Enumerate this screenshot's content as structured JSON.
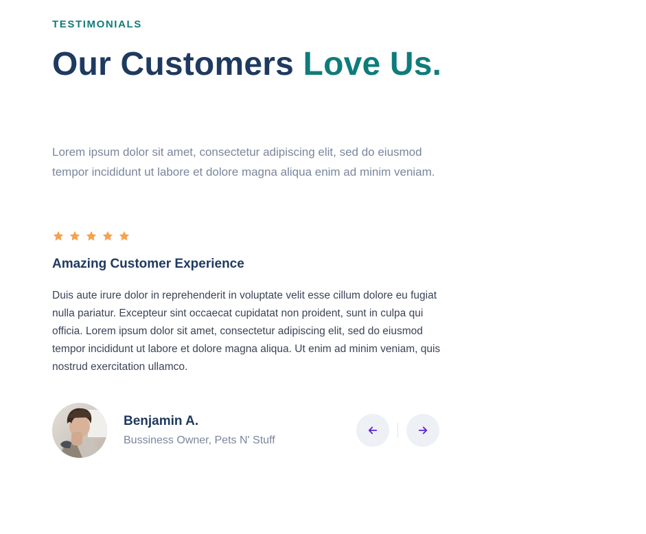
{
  "testimonials": {
    "eyebrow": "TESTIMONIALS",
    "heading_main": "Our Customers ",
    "heading_accent": "Love Us.",
    "intro": "Lorem ipsum dolor sit amet, consectetur adipiscing elit, sed do eiusmod tempor incididunt ut labore et dolore magna aliqua enim ad minim veniam.",
    "rating": 5,
    "rating_max": 5,
    "review_title": "Amazing Customer Experience",
    "review_body": "Duis aute irure dolor in reprehenderit in voluptate velit esse cillum dolore eu fugiat nulla pariatur. Excepteur sint occaecat cupidatat non proident, sunt in culpa qui officia. Lorem ipsum dolor sit amet, consectetur adipiscing elit, sed do eiusmod tempor incididunt ut labore et dolore magna aliqua. Ut enim ad minim veniam, quis nostrud exercitation ullamco.",
    "author": {
      "name": "Benjamin A.",
      "role": "Bussiness Owner, Pets N' Stuff",
      "avatar_icon": "avatar-photo"
    },
    "nav": {
      "prev_icon": "arrow-left-icon",
      "next_icon": "arrow-right-icon"
    }
  },
  "colors": {
    "accent": "#0f7c7b",
    "heading": "#1f3a60",
    "muted": "#7a869c",
    "body": "#3a4356",
    "star": "#f3a24f",
    "nav_bg": "#edf0f5",
    "nav_arrow": "#5b21d6"
  }
}
